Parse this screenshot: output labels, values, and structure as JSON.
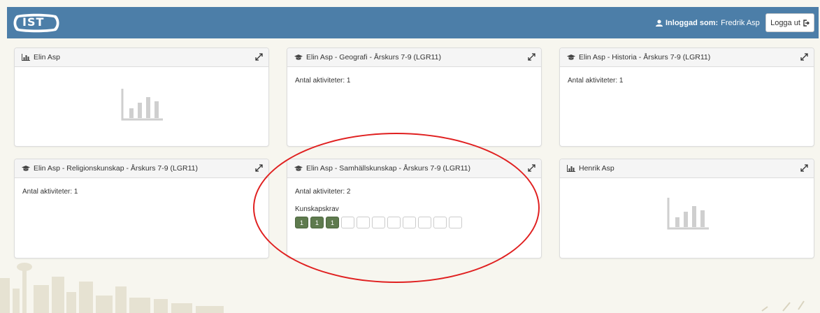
{
  "header": {
    "logo_text": "IST",
    "login_label": "Inloggad som:",
    "user_name": "Fredrik Asp",
    "logout_label": "Logga ut"
  },
  "panels": [
    {
      "title": "Elin Asp",
      "icon": "bar-chart-icon"
    },
    {
      "title": "Elin Asp - Geografi - Årskurs 7-9 (LGR11)",
      "icon": "graduation-cap-icon",
      "activities": "Antal aktiviteter: 1"
    },
    {
      "title": "Elin Asp - Historia - Årskurs 7-9 (LGR11)",
      "icon": "graduation-cap-icon",
      "activities": "Antal aktiviteter: 1"
    },
    {
      "title": "Elin Asp - Religionskunskap - Årskurs 7-9 (LGR11)",
      "icon": "graduation-cap-icon",
      "activities": "Antal aktiviteter: 1"
    },
    {
      "title": "Elin Asp - Samhällskunskap - Årskurs 7-9 (LGR11)",
      "icon": "graduation-cap-icon",
      "activities": "Antal aktiviteter: 2",
      "requirements_label": "Kunskapskrav",
      "requirement_boxes": [
        "1",
        "1",
        "1",
        "",
        "",
        "",
        "",
        "",
        "",
        "",
        ""
      ]
    },
    {
      "title": "Henrik Asp",
      "icon": "bar-chart-icon"
    }
  ],
  "colors": {
    "header_bg": "#4c7ea8",
    "filled_box": "#5e7a4e",
    "annotation": "#e02020"
  }
}
